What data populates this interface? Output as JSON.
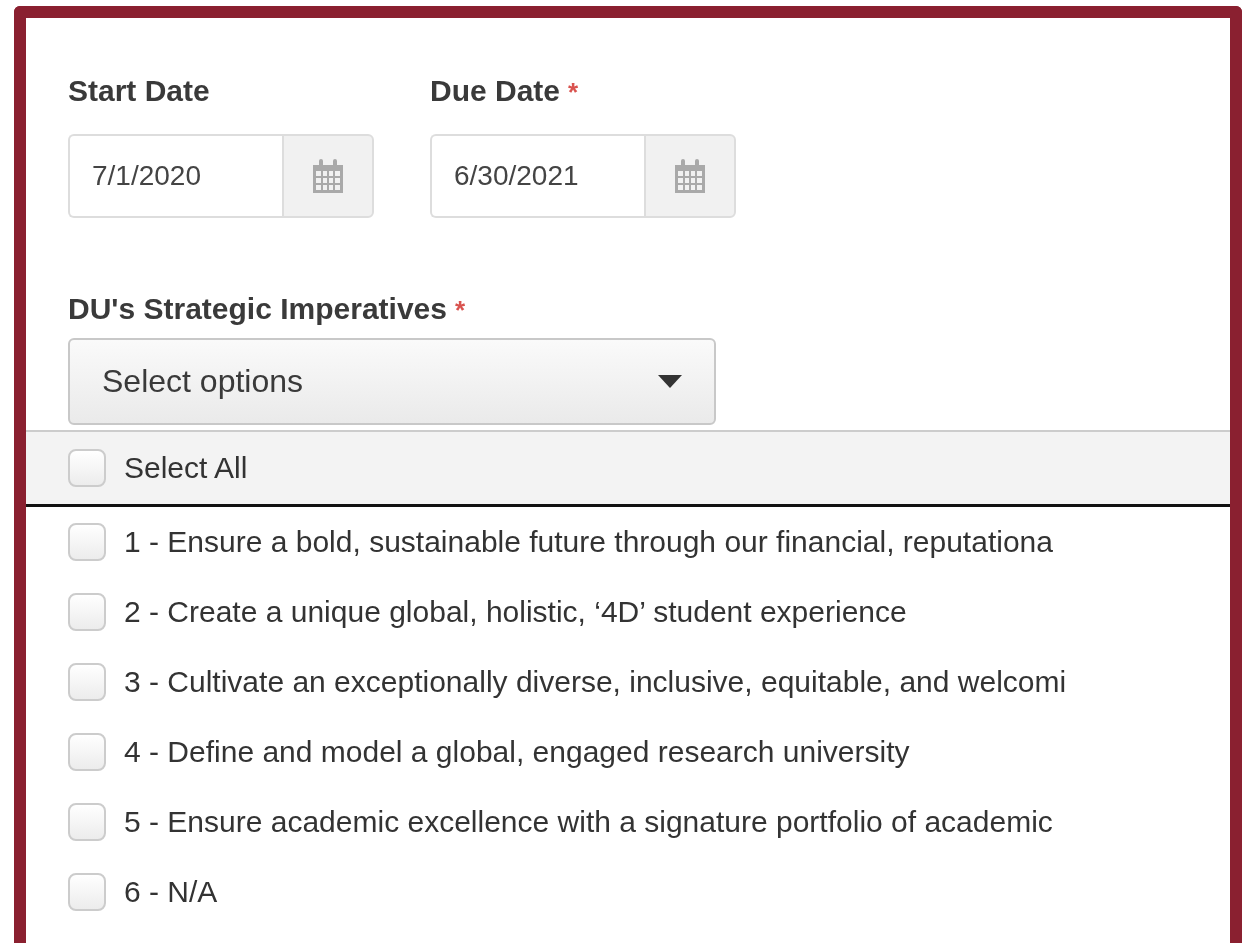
{
  "date_fields": [
    {
      "label": "Start Date",
      "required": false,
      "value": "7/1/2020"
    },
    {
      "label": "Due Date",
      "required": true,
      "value": "6/30/2021"
    }
  ],
  "required_mark": "*",
  "imperatives": {
    "label": "DU's Strategic Imperatives",
    "required": true,
    "placeholder": "Select options",
    "select_all": {
      "label": "Select All",
      "checked": false
    },
    "options": [
      {
        "label": "1 - Ensure a bold, sustainable future through our financial, reputationa",
        "checked": false
      },
      {
        "label": "2 - Create a unique global, holistic, ‘4D’ student experience",
        "checked": false
      },
      {
        "label": "3 - Cultivate an exceptionally diverse, inclusive, equitable, and welcomi",
        "checked": false
      },
      {
        "label": "4 - Define and model a global, engaged research university",
        "checked": false
      },
      {
        "label": "5 - Ensure academic excellence with a signature portfolio of academic",
        "checked": false
      },
      {
        "label": "6 - N/A",
        "checked": false
      }
    ]
  }
}
